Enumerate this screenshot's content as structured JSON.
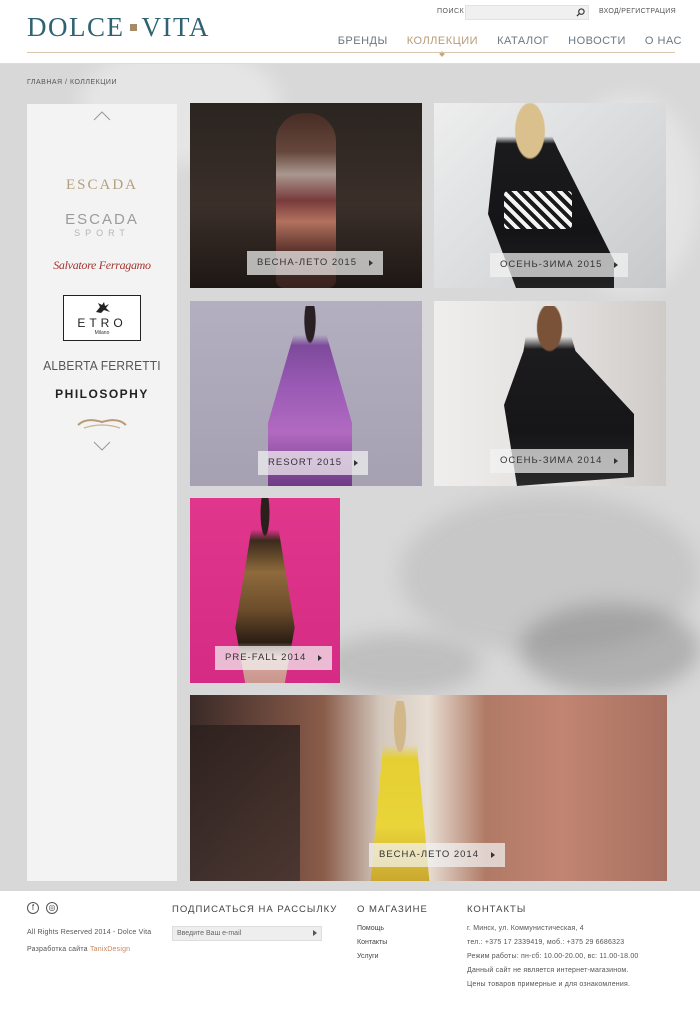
{
  "header": {
    "logo_left": "DOLCE",
    "logo_right": "VITA",
    "search_label": "ПОИСК",
    "search_placeholder": "",
    "login_label": "ВХОД/РЕГИСТРАЦИЯ",
    "nav": [
      {
        "label": "БРЕНДЫ",
        "active": false
      },
      {
        "label": "КОЛЛЕКЦИИ",
        "active": true
      },
      {
        "label": "КАТАЛОГ",
        "active": false
      },
      {
        "label": "НОВОСТИ",
        "active": false
      },
      {
        "label": "О НАС",
        "active": false
      }
    ]
  },
  "breadcrumb": "ГЛАВНАЯ / КОЛЛЕКЦИИ",
  "brands": {
    "escada": "ESCADA",
    "escada_sport_a": "ESCADA",
    "escada_sport_b": "SPORT",
    "ferragamo": "Salvatore Ferragamo",
    "etro": "ETRO",
    "etro_sub": "Milano",
    "ferretti": "ALBERTA FERRETTI",
    "philosophy": "PHILOSOPHY"
  },
  "collections": [
    {
      "label": "ВЕСНА-ЛЕТО 2015"
    },
    {
      "label": "ОСЕНЬ-ЗИМА 2015"
    },
    {
      "label": "RESORT 2015"
    },
    {
      "label": "ОСЕНЬ-ЗИМА 2014"
    },
    {
      "label": "PRE-FALL 2014"
    },
    {
      "label": "ВЕСНА-ЛЕТО 2014"
    }
  ],
  "footer": {
    "facebook_icon_text": "f",
    "instagram_icon_text": "◎",
    "copyright": "All Rights Reserved 2014 - Dolce Vita",
    "dev_prefix": "Разработка сайта",
    "dev_name": "TanixDesign",
    "subscribe_title": "ПОДПИСАТЬСЯ НА РАССЫЛКУ",
    "email_placeholder": "Введите Ваш e-mail",
    "about_title": "О МАГАЗИНЕ",
    "about_links": [
      "Помощь",
      "Контакты",
      "Услуги"
    ],
    "contacts_title": "КОНТАКТЫ",
    "contacts_lines": [
      "г. Минск, ул. Коммунистическая, 4",
      "тел.: +375 17 2339419, моб.: +375 29 6686323",
      "Режим работы: пн-сб: 10.00-20.00, вс: 11.00-18.00",
      "Данный сайт не является интернет-магазином.",
      "Цены товаров примерные и для ознакомления."
    ]
  },
  "colors": {
    "logo": "#2f6272",
    "accent_gold": "#b89a76",
    "nav_text": "#6b7780",
    "main_bg": "#d8d8d8",
    "sidebar_bg": "#f3f3f3"
  }
}
